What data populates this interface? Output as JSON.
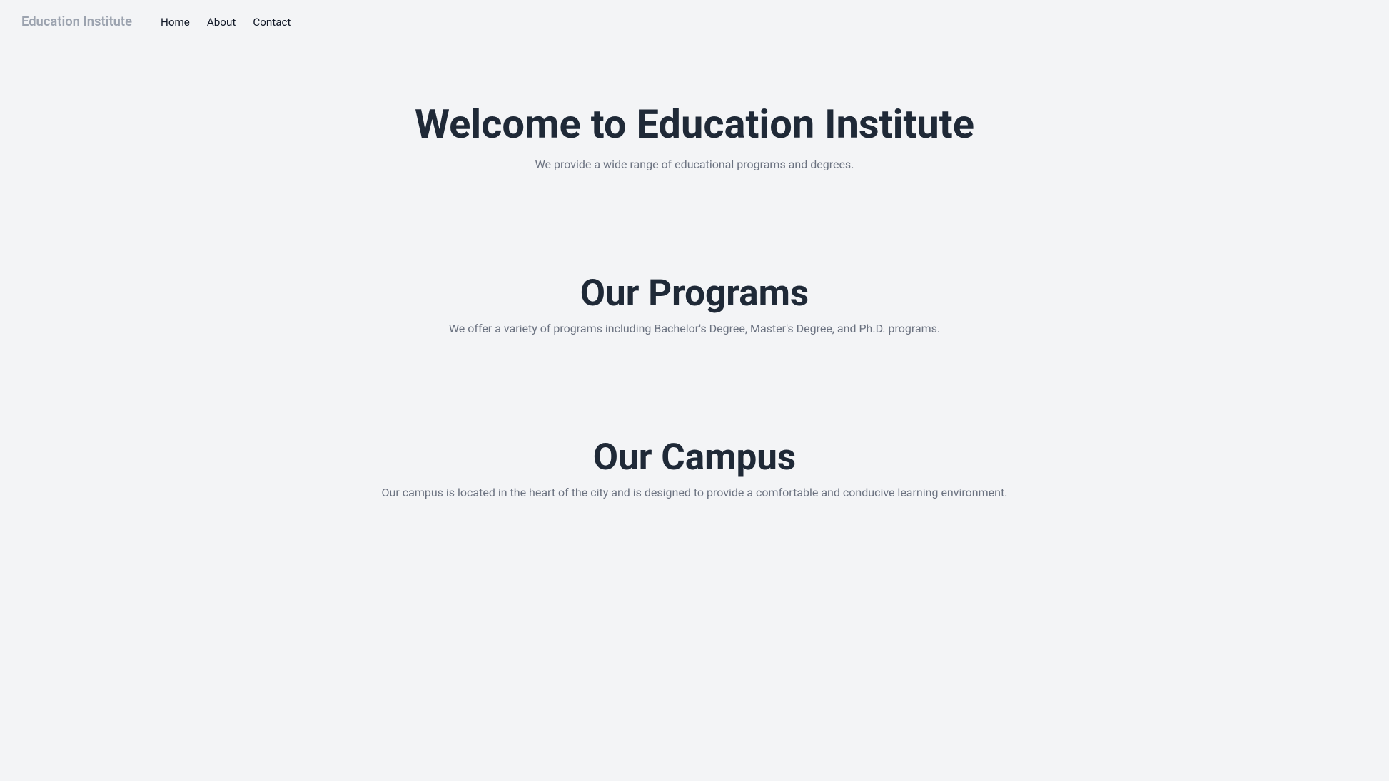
{
  "nav": {
    "brand": "Education Institute",
    "links": [
      {
        "label": "Home",
        "href": "#"
      },
      {
        "label": "About",
        "href": "#"
      },
      {
        "label": "Contact",
        "href": "#"
      }
    ]
  },
  "hero": {
    "title": "Welcome to Education Institute",
    "subtitle": "We provide a wide range of educational programs and degrees."
  },
  "programs": {
    "title": "Our Programs",
    "description": "We offer a variety of programs including Bachelor's Degree, Master's Degree, and Ph.D. programs."
  },
  "campus": {
    "title": "Our Campus",
    "description": "Our campus is located in the heart of the city and is designed to provide a comfortable and conducive learning environment."
  }
}
